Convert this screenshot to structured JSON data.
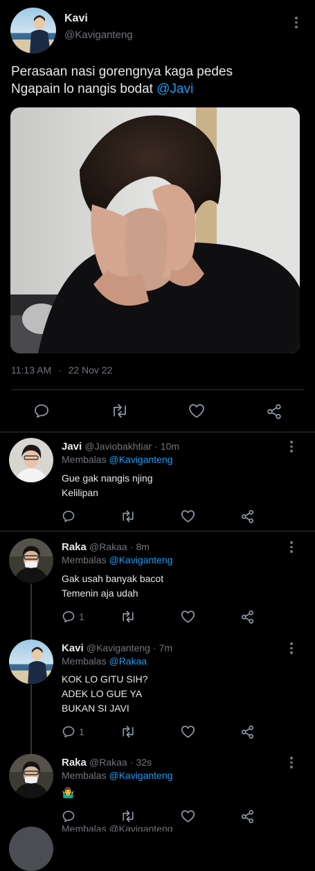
{
  "main_tweet": {
    "name": "Kavi",
    "handle": "@Kaviganteng",
    "text_line1": "Perasaan nasi gorengnya kaga pedes",
    "text_line2_prefix": "Ngapain lo nangis bodat ",
    "mention": "@Javi",
    "time": "11:13 AM",
    "dot": "·",
    "date": "22 Nov 22"
  },
  "replies": [
    {
      "name": "Javi",
      "handle": "@Javiobakhtiar",
      "age": "· 10m",
      "replying_label": "Membalas",
      "replying_to": "@Kaviganteng",
      "text": "Gue gak nangis njing\nKelilipan",
      "reply_count": ""
    },
    {
      "name": "Raka",
      "handle": "@Rakaa",
      "age": "· 8m",
      "replying_label": "Membalas",
      "replying_to": "@Kaviganteng",
      "text": "Gak usah banyak bacot\nTemenin aja udah",
      "reply_count": "1"
    },
    {
      "name": "Kavi",
      "handle": "@Kaviganteng",
      "age": "· 7m",
      "replying_label": "Membalas",
      "replying_to": "@Rakaa",
      "text": "KOK LO GITU SIH?\nADEK LO GUE YA\nBUKAN SI JAVI",
      "reply_count": "1"
    },
    {
      "name": "Raka",
      "handle": "@Rakaa",
      "age": "· 32s",
      "replying_label": "Membalas",
      "replying_to": "@Kaviganteng",
      "text": "🤷‍♂️",
      "reply_count": ""
    }
  ],
  "cutoff_text": "Membalas @Kaviganteng",
  "icons": {
    "reply": "reply-icon",
    "retweet": "retweet-icon",
    "like": "heart-icon",
    "share": "share-icon",
    "more": "more-vertical-icon"
  },
  "colors": {
    "background": "#000000",
    "text": "#e7e9ea",
    "muted": "#71767b",
    "link": "#1d9bf0"
  }
}
